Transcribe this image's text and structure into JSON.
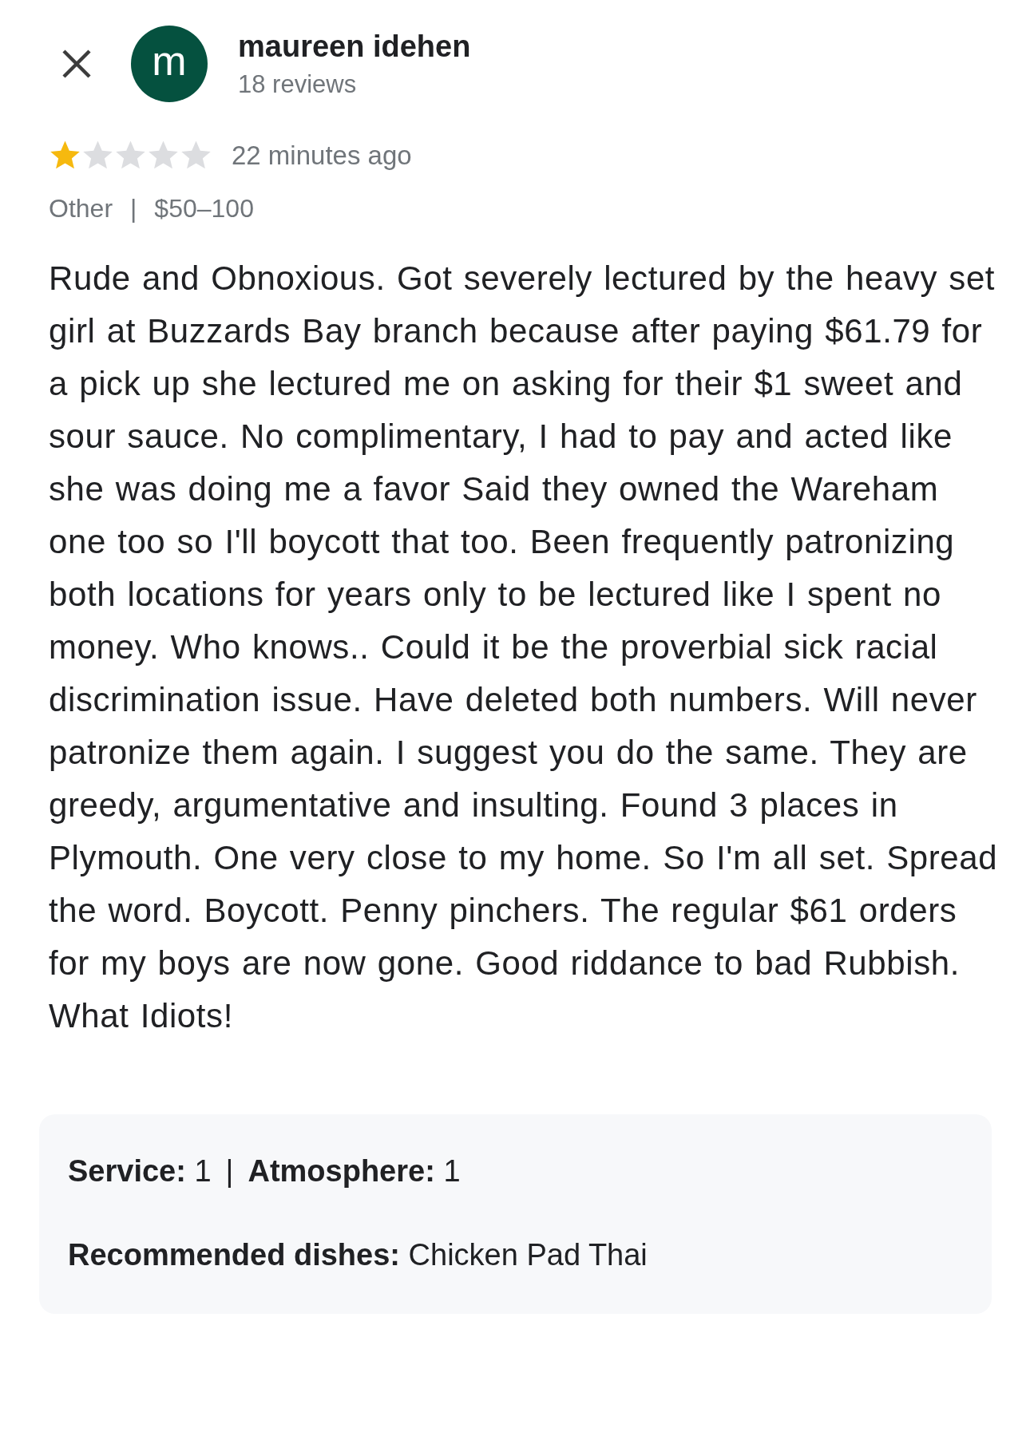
{
  "reviewer": {
    "initial": "m",
    "name": "maureen idehen",
    "review_count": "18 reviews"
  },
  "review": {
    "stars": 1,
    "time": "22 minutes ago",
    "meta": [
      "Other",
      "|",
      "$50–100"
    ],
    "text": "Rude and Obnoxious. Got severely lectured by the heavy set girl at Buzzards Bay branch because after paying $61.79 for a pick up she lectured me on asking for their $1 sweet and sour sauce. No complimentary, I had to pay and acted like she was doing me a favor Said they owned the Wareham one too so I'll boycott that too. Been frequently patronizing both locations for years only to be lectured like I spent no money. Who knows.. Could it be the proverbial sick racial discrimination issue. Have deleted both numbers. Will never patronize them again. I suggest you do the same. They are greedy, argumentative and insulting. Found 3 places in Plymouth. One very close to my home. So I'm all set. Spread the word. Boycott. Penny pinchers. The regular $61 orders for my boys are now gone. Good riddance to bad Rubbish. What Idiots!"
  },
  "details": {
    "ratings": [
      "**Service:** 1",
      "|",
      "**Atmosphere:** 1"
    ],
    "recommended": "**Recommended dishes:** Chicken Pad Thai"
  }
}
